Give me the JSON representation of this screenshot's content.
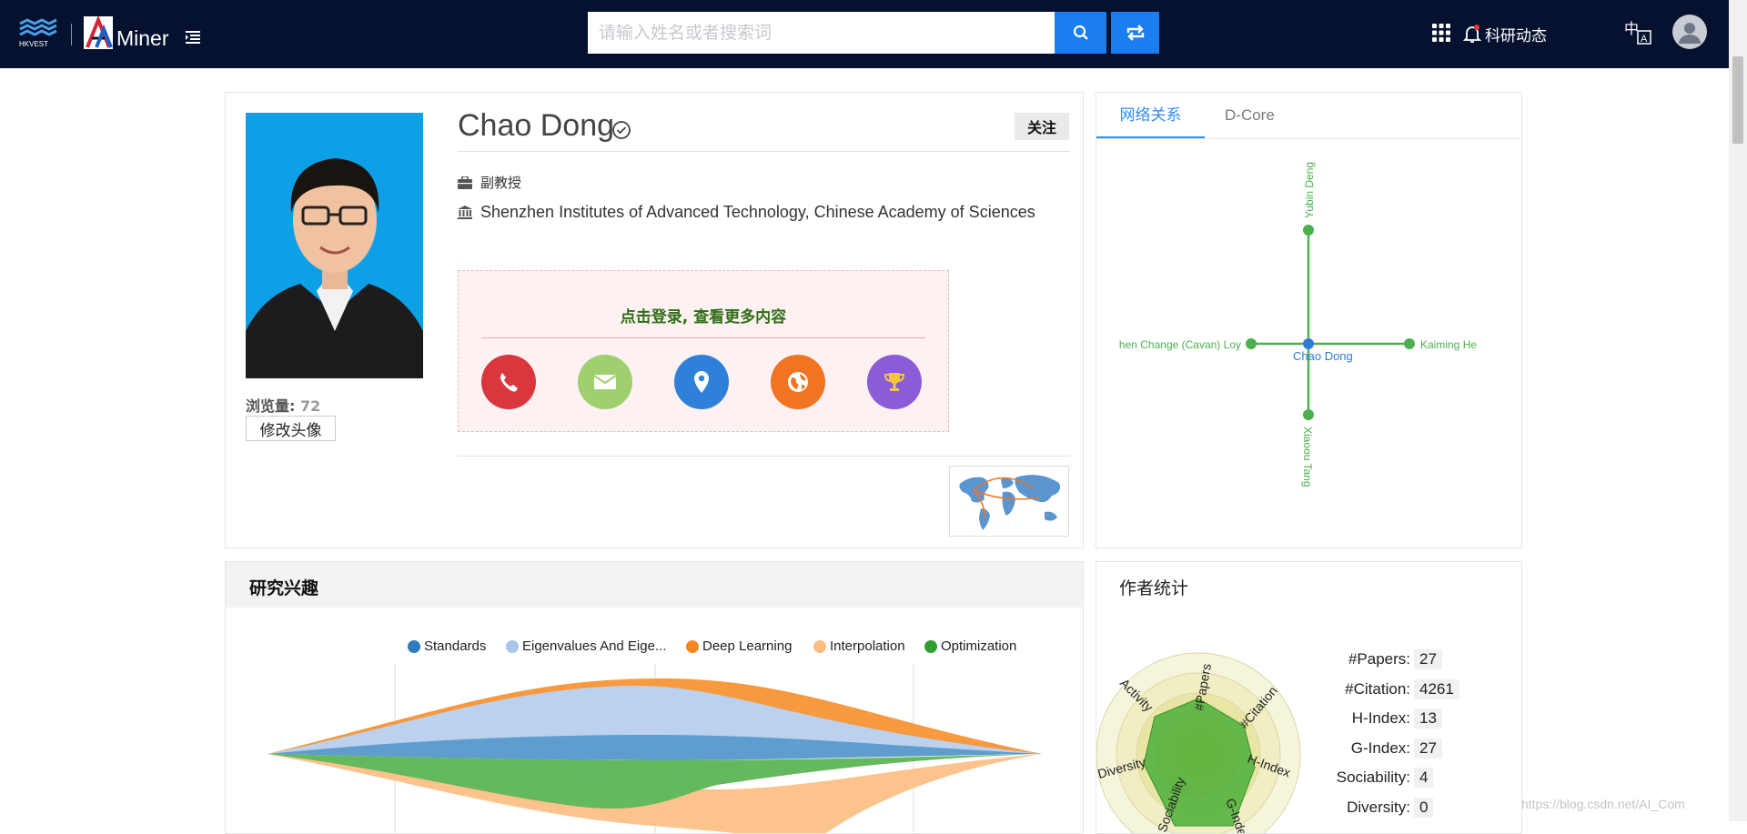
{
  "header": {
    "logo_hk": "HKVEST",
    "logo_am": "Miner",
    "search_placeholder": "请输入姓名或者搜索词",
    "news_label": "科研动态",
    "lang_label": "中A",
    "colors": {
      "bar": "#05112e",
      "accent": "#1a7ef0"
    },
    "icons": [
      "menu-icon",
      "search-icon",
      "swap-icon",
      "apps-grid-icon",
      "bell-icon",
      "language-icon",
      "user-avatar-icon"
    ]
  },
  "profile": {
    "name": "Chao Dong",
    "follow_label": "关注",
    "title": "副教授",
    "institution": "Shenzhen Institutes of Advanced Technology, Chinese Academy of Sciences",
    "views_label": "浏览量:",
    "views_value": "72",
    "edit_avatar_label": "修改头像",
    "login_prompt": "点击登录, 查看更多内容",
    "contacts": [
      {
        "icon": "phone-icon",
        "color": "#d9363e"
      },
      {
        "icon": "email-icon",
        "color": "#9fcf6f"
      },
      {
        "icon": "location-icon",
        "color": "#2f80d8"
      },
      {
        "icon": "homepage-icon",
        "color": "#f07421"
      },
      {
        "icon": "award-icon",
        "color": "#8a5cd8"
      }
    ]
  },
  "network": {
    "tabs": [
      "网络关系",
      "D-Core"
    ],
    "center": "Chao Dong",
    "nodes": [
      "Yubin Deng",
      "Kaiming He",
      "Xiaoou Tang",
      "Chen Change (Cavan) Loy"
    ]
  },
  "interests": {
    "title": "研究兴趣",
    "legend": [
      {
        "label": "Standards",
        "color": "#2f7bbd"
      },
      {
        "label": "Eigenvalues And Eige...",
        "color": "#a9c6e8"
      },
      {
        "label": "Deep Learning",
        "color": "#f68720"
      },
      {
        "label": "Interpolation",
        "color": "#fbbd80"
      },
      {
        "label": "Optimization",
        "color": "#2ea02c"
      }
    ]
  },
  "stats": {
    "title": "作者统计",
    "rows": [
      {
        "label": "#Papers:",
        "value": "27"
      },
      {
        "label": "#Citation:",
        "value": "4261"
      },
      {
        "label": "H-Index:",
        "value": "13"
      },
      {
        "label": "G-Index:",
        "value": "27"
      },
      {
        "label": "Sociability:",
        "value": "4"
      },
      {
        "label": "Diversity:",
        "value": "0"
      }
    ],
    "radar_axes": [
      "#Papers",
      "#Citation",
      "H-Index",
      "G-Index",
      "Sociability",
      "Diversity",
      "Activity"
    ]
  },
  "watermark": "https://blog.csdn.net/AI_Com"
}
